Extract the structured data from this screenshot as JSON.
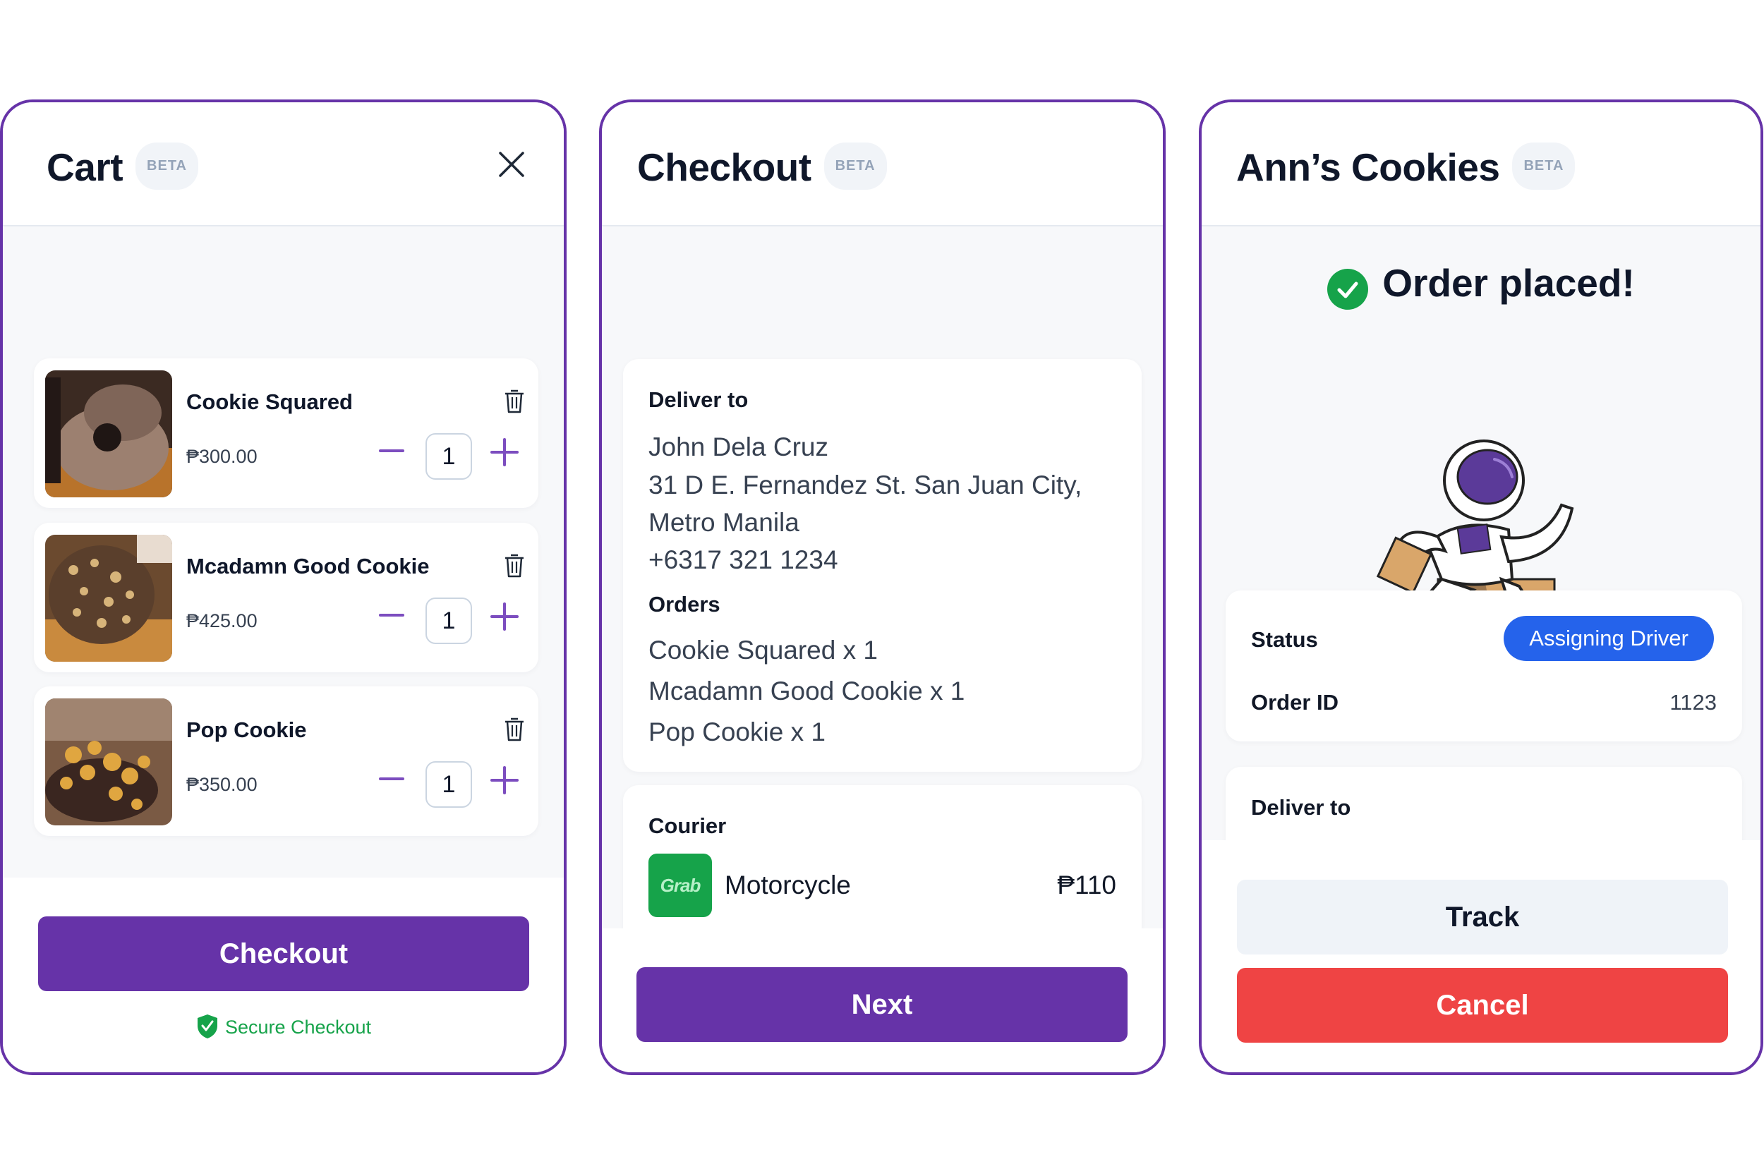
{
  "cart": {
    "title": "Cart",
    "badge": "BETA",
    "items": [
      {
        "name": "Cookie Squared",
        "price": "₱300.00",
        "quantity": "1"
      },
      {
        "name": "Mcadamn Good Cookie",
        "price": "₱425.00",
        "quantity": "1"
      },
      {
        "name": "Pop Cookie",
        "price": "₱350.00",
        "quantity": "1"
      }
    ],
    "checkout_label": "Checkout",
    "secure_label": "Secure Checkout"
  },
  "checkout": {
    "title": "Checkout",
    "badge": "BETA",
    "deliver_to_label": "Deliver to",
    "recipient_name": "John Dela Cruz",
    "address_line1": "31 D E. Fernandez St. San Juan City,",
    "address_line2": "Metro Manila",
    "phone": "+6317 321 1234",
    "orders_label": "Orders",
    "orders": [
      "Cookie Squared x 1",
      "Mcadamn Good Cookie x 1",
      "Pop Cookie x 1"
    ],
    "courier_label": "Courier",
    "courier_logo_text": "Grab",
    "courier_option": "Motorcycle",
    "courier_price": "₱110",
    "next_label": "Next"
  },
  "confirmation": {
    "title": "Ann’s Cookies",
    "badge": "BETA",
    "heading": "Order placed!",
    "status_label": "Status",
    "status_value": "Assigning Driver",
    "order_id_label": "Order ID",
    "order_id_value": "1123",
    "deliver_to_label": "Deliver to",
    "track_label": "Track",
    "cancel_label": "Cancel"
  },
  "colors": {
    "brand_purple": "#6633a8",
    "success_green": "#16a34a",
    "status_blue": "#2563eb",
    "danger_red": "#ef4444",
    "grab_green": "#16a34a"
  }
}
